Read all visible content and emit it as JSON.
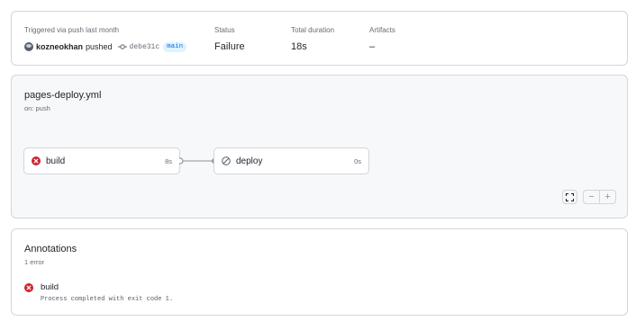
{
  "summary": {
    "trigger_label": "Triggered via push last month",
    "actor": "kozneokhan",
    "action": "pushed",
    "commit_sha": "debe31c",
    "branch": "main",
    "status_label": "Status",
    "status_value": "Failure",
    "duration_label": "Total duration",
    "duration_value": "18s",
    "artifacts_label": "Artifacts",
    "artifacts_value": "–"
  },
  "workflow": {
    "file": "pages-deploy.yml",
    "trigger": "on: push",
    "jobs": [
      {
        "name": "build",
        "duration": "8s",
        "status": "failure",
        "icon": "x-circle-fill-icon"
      },
      {
        "name": "deploy",
        "duration": "0s",
        "status": "skipped",
        "icon": "skip-icon"
      }
    ],
    "controls": {
      "fit": "fullscreen-icon",
      "zoom_out": "−",
      "zoom_in": "+"
    }
  },
  "annotations": {
    "title": "Annotations",
    "count": "1 error",
    "items": [
      {
        "job": "build",
        "message": "Process completed with exit code 1.",
        "icon": "x-circle-fill-icon"
      }
    ]
  },
  "colors": {
    "failure": "#cf222e",
    "muted": "#656d76",
    "border": "#d0d7de",
    "branch_bg": "#ddf4ff",
    "branch_fg": "#0969da",
    "graph_bg": "#f6f8fa"
  }
}
